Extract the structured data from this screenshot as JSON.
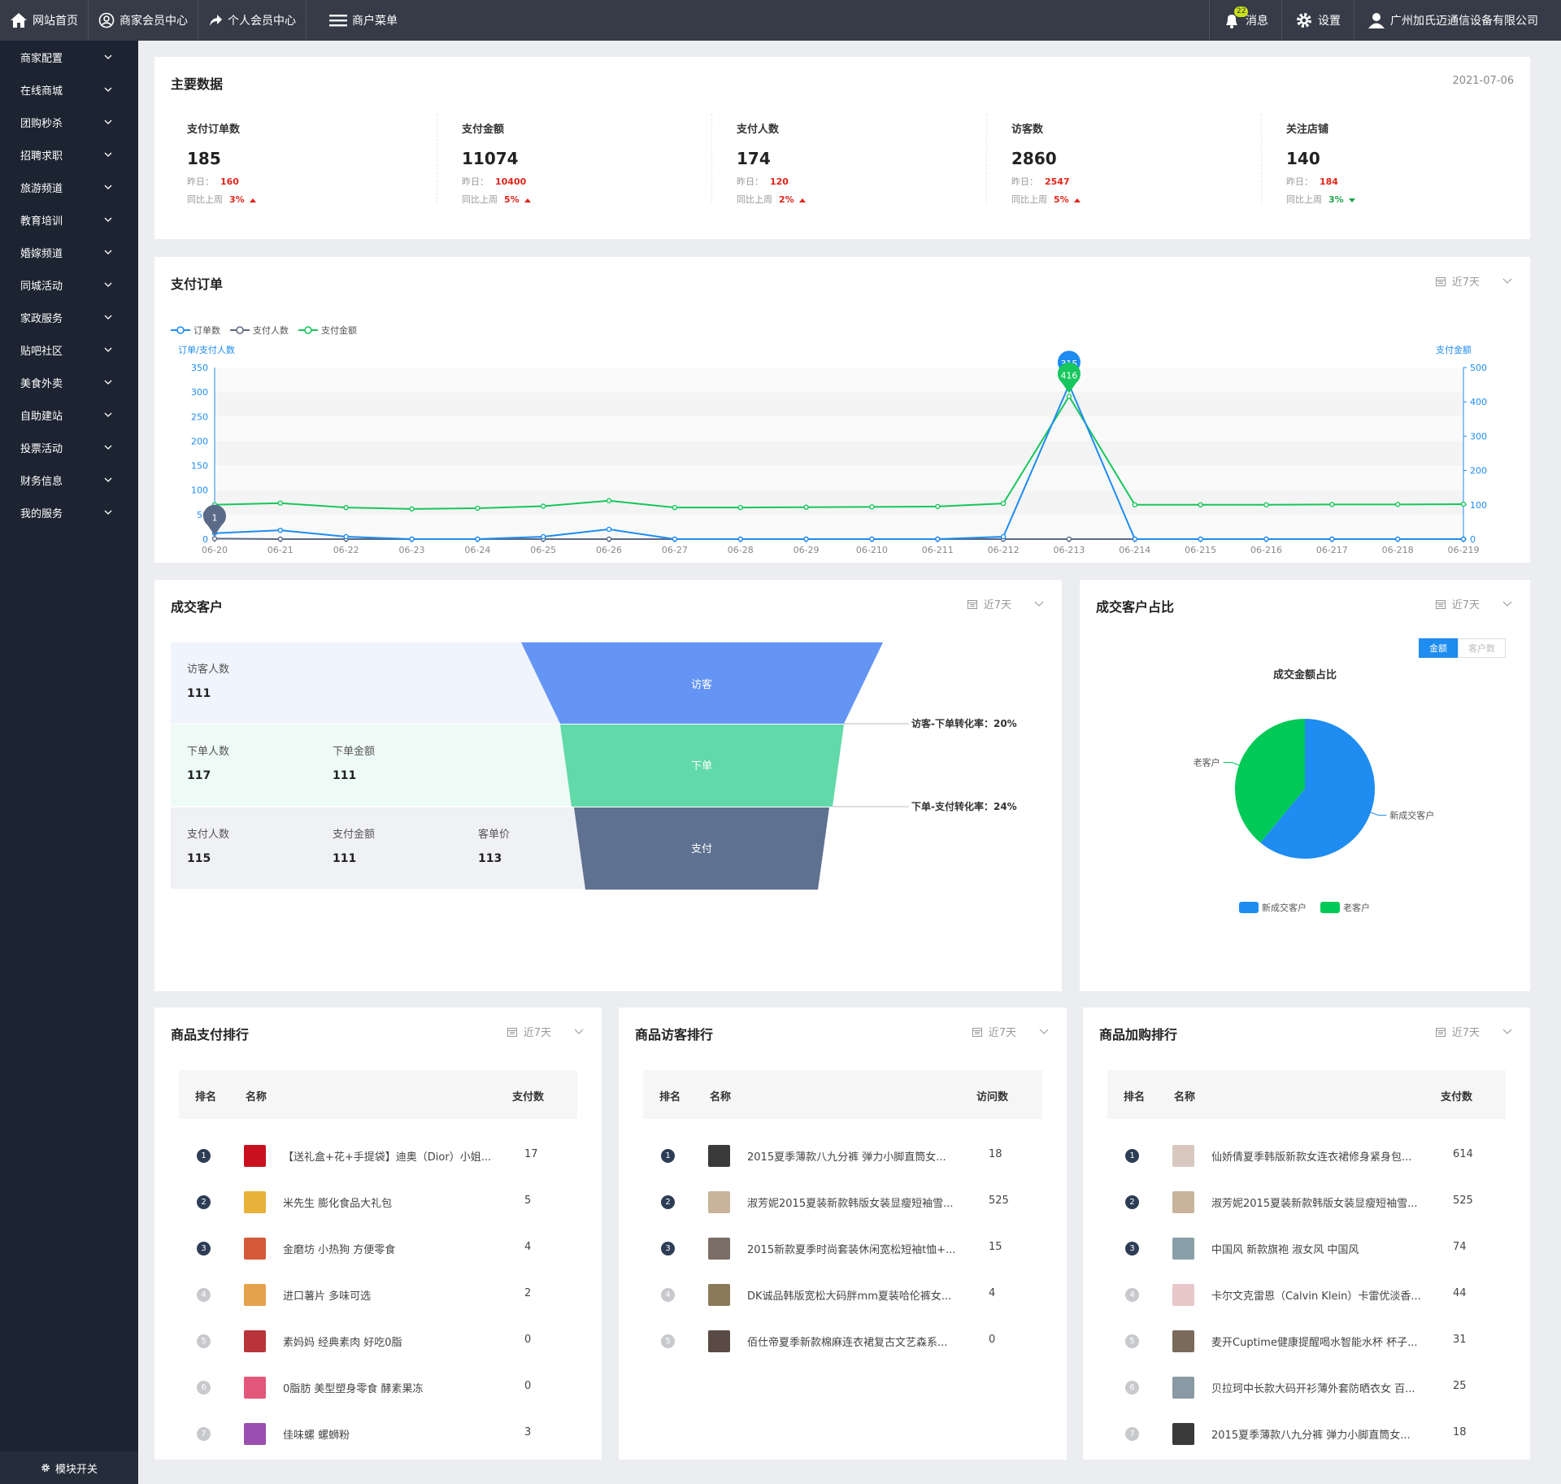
{
  "topbar": {
    "home": "网站首页",
    "merchant_center": "商家会员中心",
    "personal_center": "个人会员中心",
    "merchant_menu": "商户菜单",
    "messages": "消息",
    "message_count": "22",
    "settings": "设置",
    "company": "广州加氏迈通信设备有限公司"
  },
  "sidebar": {
    "items": [
      "商家配置",
      "在线商城",
      "团购秒杀",
      "招聘求职",
      "旅游频道",
      "教育培训",
      "婚嫁频道",
      "同城活动",
      "家政服务",
      "贴吧社区",
      "美食外卖",
      "自助建站",
      "投票活动",
      "财务信息",
      "我的服务"
    ],
    "footer": "模块开关"
  },
  "main_data": {
    "title": "主要数据",
    "date": "2021-07-06",
    "kpis": [
      {
        "label": "支付订单数",
        "value": "185",
        "yesterday_label": "昨日：",
        "yesterday": "160",
        "week_label": "同比上周",
        "week": "3%",
        "trend": "up"
      },
      {
        "label": "支付金额",
        "value": "11074",
        "yesterday_label": "昨日：",
        "yesterday": "10400",
        "week_label": "同比上周",
        "week": "5%",
        "trend": "up"
      },
      {
        "label": "支付人数",
        "value": "174",
        "yesterday_label": "昨日：",
        "yesterday": "120",
        "week_label": "同比上周",
        "week": "2%",
        "trend": "up"
      },
      {
        "label": "访客数",
        "value": "2860",
        "yesterday_label": "昨日：",
        "yesterday": "2547",
        "week_label": "同比上周",
        "week": "5%",
        "trend": "up"
      },
      {
        "label": "关注店铺",
        "value": "140",
        "yesterday_label": "昨日：",
        "yesterday": "184",
        "week_label": "同比上周",
        "week": "3%",
        "trend": "down"
      }
    ]
  },
  "pay_orders": {
    "title": "支付订单",
    "period": "近7天",
    "chart_data": {
      "type": "line",
      "legend": [
        "订单数",
        "支付人数",
        "支付金额"
      ],
      "ylabel_left": "订单/支付人数",
      "ylabel_right": "支付金额",
      "ylim_left": [
        0,
        350
      ],
      "ylim_right": [
        0,
        500
      ],
      "yticks_left": [
        "0",
        "50",
        "100",
        "150",
        "200",
        "250",
        "300",
        "350"
      ],
      "yticks_right": [
        "0",
        "100",
        "200",
        "300",
        "400",
        "500"
      ],
      "categories": [
        "06-20",
        "06-21",
        "06-22",
        "06-23",
        "06-24",
        "06-25",
        "06-26",
        "06-27",
        "06-28",
        "06-29",
        "06-210",
        "06-211",
        "06-212",
        "06-213",
        "06-214",
        "06-215",
        "06-216",
        "06-217",
        "06-218",
        "06-219"
      ],
      "series": [
        {
          "name": "订单数",
          "color": "#1e8cf0",
          "axis": "left",
          "values": [
            12,
            18,
            5,
            0,
            0,
            5,
            20,
            0,
            0,
            0,
            0,
            0,
            5,
            315,
            0,
            0,
            0,
            0,
            0,
            0
          ]
        },
        {
          "name": "支付人数",
          "color": "#5b6a86",
          "axis": "left",
          "values": [
            1,
            0,
            0,
            0,
            0,
            0,
            0,
            0,
            0,
            0,
            0,
            0,
            0,
            0,
            0,
            0,
            0,
            0,
            0,
            0
          ]
        },
        {
          "name": "支付金额",
          "color": "#17c65c",
          "axis": "right",
          "values": [
            100,
            105,
            92,
            88,
            90,
            96,
            112,
            92,
            92,
            93,
            94,
            95,
            104,
            416,
            100,
            100,
            100,
            101,
            101,
            102
          ]
        }
      ],
      "annotations": [
        {
          "label": "315",
          "category": "06-213",
          "series": "订单数"
        },
        {
          "label": "416",
          "category": "06-213",
          "series": "支付金额"
        },
        {
          "label": "1",
          "category": "06-20",
          "series": "支付人数"
        }
      ]
    }
  },
  "deal_customers": {
    "title": "成交客户",
    "period": "近7天",
    "rows": [
      {
        "cells": [
          {
            "label": "访客人数",
            "value": "111"
          }
        ],
        "stage": "访客"
      },
      {
        "cells": [
          {
            "label": "下单人数",
            "value": "117"
          },
          {
            "label": "下单金额",
            "value": "111"
          }
        ],
        "stage": "下单"
      },
      {
        "cells": [
          {
            "label": "支付人数",
            "value": "115"
          },
          {
            "label": "支付金额",
            "value": "111"
          },
          {
            "label": "客单价",
            "value": "113"
          }
        ],
        "stage": "支付"
      }
    ],
    "conversion1": "访客-下单转化率：20%",
    "conversion2": "下单-支付转化率：24%"
  },
  "customer_ratio": {
    "title": "成交客户占比",
    "period": "近7天",
    "tab_amount": "金额",
    "tab_count": "客户数",
    "chart_data": {
      "type": "pie",
      "title": "成交金额占比",
      "slices": [
        {
          "name": "新成交客户",
          "value": 61,
          "color": "#1e8cf0"
        },
        {
          "name": "老客户",
          "value": 39,
          "color": "#00c957"
        }
      ],
      "legend": [
        "新成交客户",
        "老客户"
      ]
    }
  },
  "rank_pay": {
    "title": "商品支付排行",
    "period": "近7天",
    "headers": [
      "排名",
      "名称",
      "支付数"
    ],
    "rows": [
      {
        "rank": "1",
        "name": "【送礼盒+花+手提袋】迪奥（Dior）小姐...",
        "count": "17",
        "color": "#c8101e"
      },
      {
        "rank": "2",
        "name": "米先生 膨化食品大礼包",
        "count": "5",
        "color": "#e8b23a"
      },
      {
        "rank": "3",
        "name": "金磨坊 小热狗 方便零食",
        "count": "4",
        "color": "#d45a3a"
      },
      {
        "rank": "4",
        "name": "进口薯片 多味可选",
        "count": "2",
        "color": "#e6a24b"
      },
      {
        "rank": "5",
        "name": "素妈妈 经典素肉 好吃0脂",
        "count": "0",
        "color": "#b8343a"
      },
      {
        "rank": "6",
        "name": "0脂肪 美型塑身零食 酵素果冻",
        "count": "0",
        "color": "#e2577a"
      },
      {
        "rank": "7",
        "name": "佳味螺 螺蛳粉",
        "count": "3",
        "color": "#9a4fb0"
      }
    ]
  },
  "rank_visit": {
    "title": "商品访客排行",
    "period": "近7天",
    "headers": [
      "排名",
      "名称",
      "访问数"
    ],
    "rows": [
      {
        "rank": "1",
        "name": "2015夏季薄款八九分裤 弹力小脚直筒女...",
        "count": "18",
        "color": "#3a3a3a"
      },
      {
        "rank": "2",
        "name": "淑芳妮2015夏装新款韩版女装显瘦短袖雪...",
        "count": "525",
        "color": "#c8b49a"
      },
      {
        "rank": "3",
        "name": "2015新款夏季时尚套装休闲宽松短袖t恤+...",
        "count": "15",
        "color": "#7a6e66"
      },
      {
        "rank": "4",
        "name": "DK诚品韩版宽松大码胖mm夏装哈伦裤女...",
        "count": "4",
        "color": "#8a7a5a"
      },
      {
        "rank": "5",
        "name": "佰仕帝夏季新款棉麻连衣裙复古文艺森系...",
        "count": "0",
        "color": "#5a4a44"
      }
    ]
  },
  "rank_cart": {
    "title": "商品加购排行",
    "period": "近7天",
    "headers": [
      "排名",
      "名称",
      "支付数"
    ],
    "rows": [
      {
        "rank": "1",
        "name": "仙娇倩夏季韩版新款女连衣裙修身紧身包...",
        "count": "614",
        "color": "#d8c8c0"
      },
      {
        "rank": "2",
        "name": "淑芳妮2015夏装新款韩版女装显瘦短袖雪...",
        "count": "525",
        "color": "#c8b49a"
      },
      {
        "rank": "3",
        "name": "中国风 新款旗袍 淑女风 中国风",
        "count": "74",
        "color": "#8aa0a8"
      },
      {
        "rank": "4",
        "name": "卡尔文克雷恩（Calvin Klein）卡雷优淡香...",
        "count": "44",
        "color": "#e8c8c8"
      },
      {
        "rank": "5",
        "name": "麦开Cuptime健康提醒喝水智能水杯 杯子...",
        "count": "31",
        "color": "#7a6a5a"
      },
      {
        "rank": "6",
        "name": "贝拉珂中长款大码开衫薄外套防晒衣女 百...",
        "count": "25",
        "color": "#8a9aa4"
      },
      {
        "rank": "7",
        "name": "2015夏季薄款八九分裤 弹力小脚直筒女...",
        "count": "18",
        "color": "#3a3a3a"
      }
    ]
  }
}
